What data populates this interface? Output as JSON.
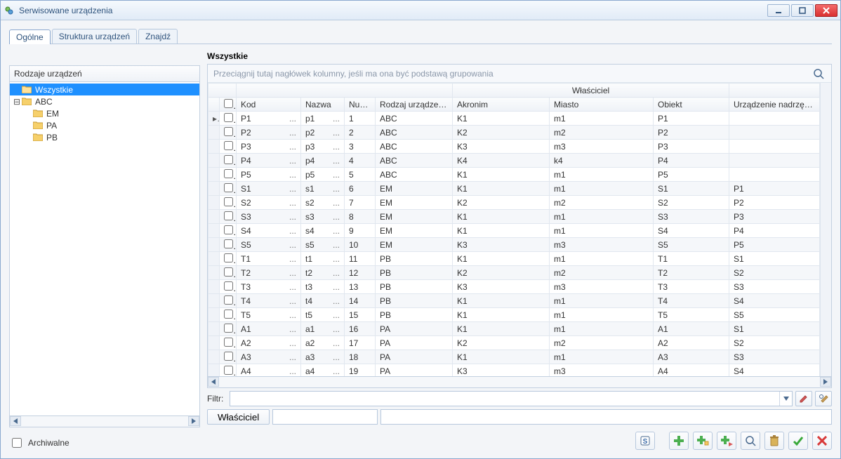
{
  "window": {
    "title": "Serwisowane urządzenia"
  },
  "tabs": [
    {
      "label": "Ogólne",
      "active": true
    },
    {
      "label": "Struktura urządzeń",
      "active": false
    },
    {
      "label": "Znajdź",
      "active": false
    }
  ],
  "tree": {
    "header": "Rodzaje urządzeń",
    "nodes": [
      {
        "label": "Wszystkie",
        "level": 0,
        "expandable": false,
        "selected": true
      },
      {
        "label": "ABC",
        "level": 0,
        "expandable": true,
        "expanded": true,
        "selected": false
      },
      {
        "label": "EM",
        "level": 1,
        "expandable": false,
        "selected": false
      },
      {
        "label": "PA",
        "level": 1,
        "expandable": false,
        "selected": false
      },
      {
        "label": "PB",
        "level": 1,
        "expandable": false,
        "selected": false
      }
    ]
  },
  "archive_label": "Archiwalne",
  "grid": {
    "title": "Wszystkie",
    "group_hint": "Przeciągnij tutaj nagłówek kolumny, jeśli ma ona być podstawą grupowania",
    "band_owner": "Właściciel",
    "columns": {
      "kod": "Kod",
      "nazwa": "Nazwa",
      "numer": "Numer",
      "rodzaj": "Rodzaj urządzenia",
      "akronim": "Akronim",
      "miasto": "Miasto",
      "obiekt": "Obiekt",
      "nadrz": "Urządzenie nadrzędne"
    },
    "rows": [
      {
        "kod": "P1",
        "nazwa": "p1",
        "numer": "1",
        "rodzaj": "ABC",
        "akronim": "K1",
        "miasto": "m1",
        "obiekt": "P1",
        "nadrz": ""
      },
      {
        "kod": "P2",
        "nazwa": "p2",
        "numer": "2",
        "rodzaj": "ABC",
        "akronim": "K2",
        "miasto": "m2",
        "obiekt": "P2",
        "nadrz": ""
      },
      {
        "kod": "P3",
        "nazwa": "p3",
        "numer": "3",
        "rodzaj": "ABC",
        "akronim": "K3",
        "miasto": "m3",
        "obiekt": "P3",
        "nadrz": ""
      },
      {
        "kod": "P4",
        "nazwa": "p4",
        "numer": "4",
        "rodzaj": "ABC",
        "akronim": "K4",
        "miasto": "k4",
        "obiekt": "P4",
        "nadrz": ""
      },
      {
        "kod": "P5",
        "nazwa": "p5",
        "numer": "5",
        "rodzaj": "ABC",
        "akronim": "K1",
        "miasto": "m1",
        "obiekt": "P5",
        "nadrz": ""
      },
      {
        "kod": "S1",
        "nazwa": "s1",
        "numer": "6",
        "rodzaj": "EM",
        "akronim": "K1",
        "miasto": "m1",
        "obiekt": "S1",
        "nadrz": "P1"
      },
      {
        "kod": "S2",
        "nazwa": "s2",
        "numer": "7",
        "rodzaj": "EM",
        "akronim": "K2",
        "miasto": "m2",
        "obiekt": "S2",
        "nadrz": "P2"
      },
      {
        "kod": "S3",
        "nazwa": "s3",
        "numer": "8",
        "rodzaj": "EM",
        "akronim": "K1",
        "miasto": "m1",
        "obiekt": "S3",
        "nadrz": "P3"
      },
      {
        "kod": "S4",
        "nazwa": "s4",
        "numer": "9",
        "rodzaj": "EM",
        "akronim": "K1",
        "miasto": "m1",
        "obiekt": "S4",
        "nadrz": "P4"
      },
      {
        "kod": "S5",
        "nazwa": "s5",
        "numer": "10",
        "rodzaj": "EM",
        "akronim": "K3",
        "miasto": "m3",
        "obiekt": "S5",
        "nadrz": "P5"
      },
      {
        "kod": "T1",
        "nazwa": "t1",
        "numer": "11",
        "rodzaj": "PB",
        "akronim": "K1",
        "miasto": "m1",
        "obiekt": "T1",
        "nadrz": "S1"
      },
      {
        "kod": "T2",
        "nazwa": "t2",
        "numer": "12",
        "rodzaj": "PB",
        "akronim": "K2",
        "miasto": "m2",
        "obiekt": "T2",
        "nadrz": "S2"
      },
      {
        "kod": "T3",
        "nazwa": "t3",
        "numer": "13",
        "rodzaj": "PB",
        "akronim": "K3",
        "miasto": "m3",
        "obiekt": "T3",
        "nadrz": "S3"
      },
      {
        "kod": "T4",
        "nazwa": "t4",
        "numer": "14",
        "rodzaj": "PB",
        "akronim": "K1",
        "miasto": "m1",
        "obiekt": "T4",
        "nadrz": "S4"
      },
      {
        "kod": "T5",
        "nazwa": "t5",
        "numer": "15",
        "rodzaj": "PB",
        "akronim": "K1",
        "miasto": "m1",
        "obiekt": "T5",
        "nadrz": "S5"
      },
      {
        "kod": "A1",
        "nazwa": "a1",
        "numer": "16",
        "rodzaj": "PA",
        "akronim": "K1",
        "miasto": "m1",
        "obiekt": "A1",
        "nadrz": "S1"
      },
      {
        "kod": "A2",
        "nazwa": "a2",
        "numer": "17",
        "rodzaj": "PA",
        "akronim": "K2",
        "miasto": "m2",
        "obiekt": "A2",
        "nadrz": "S2"
      },
      {
        "kod": "A3",
        "nazwa": "a3",
        "numer": "18",
        "rodzaj": "PA",
        "akronim": "K1",
        "miasto": "m1",
        "obiekt": "A3",
        "nadrz": "S3"
      },
      {
        "kod": "A4",
        "nazwa": "a4",
        "numer": "19",
        "rodzaj": "PA",
        "akronim": "K3",
        "miasto": "m3",
        "obiekt": "A4",
        "nadrz": "S4"
      }
    ]
  },
  "filter": {
    "label": "Filtr:",
    "owner_btn": "Właściciel"
  }
}
